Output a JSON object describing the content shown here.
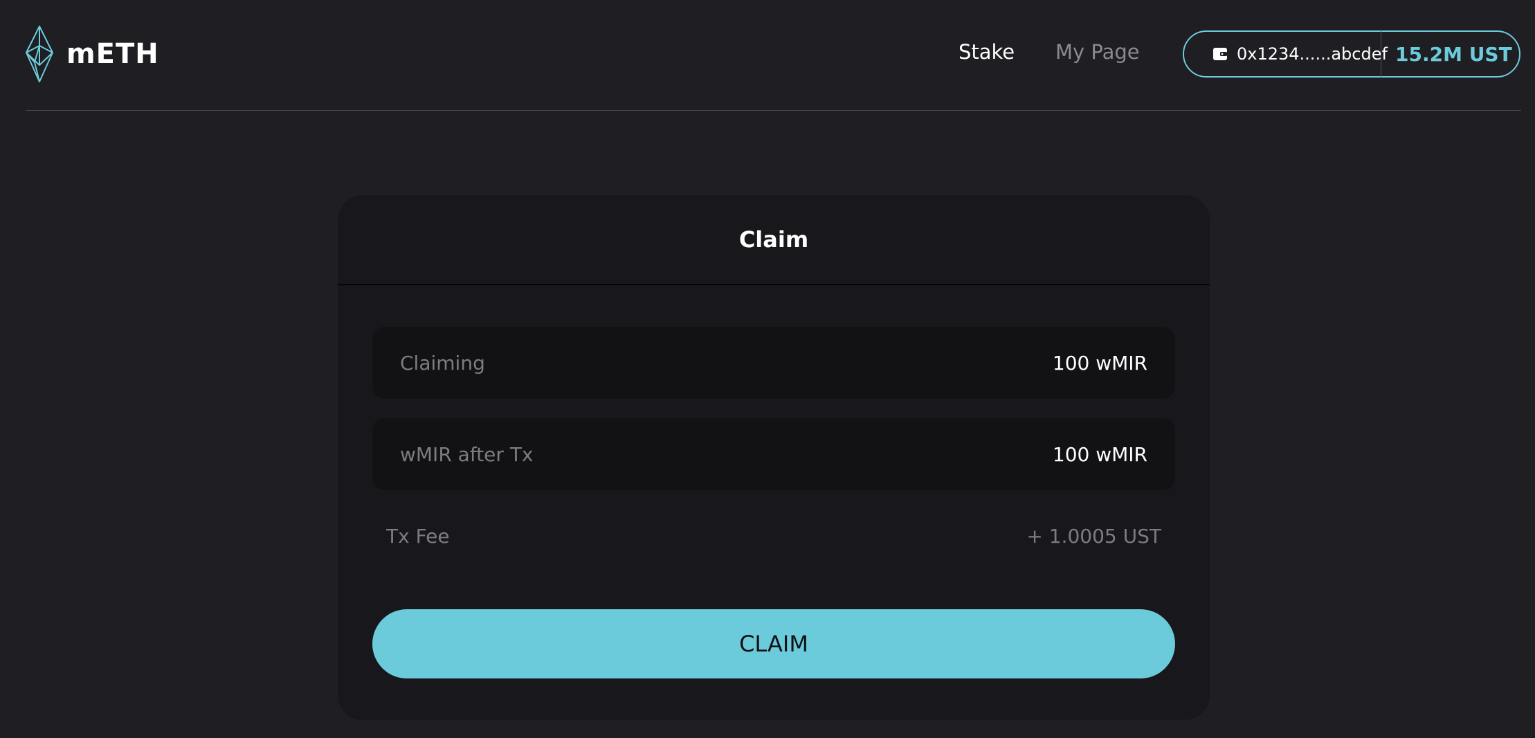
{
  "brand": {
    "name": "mETH",
    "accent": "#6ccbdb"
  },
  "nav": {
    "stake": "Stake",
    "my_page": "My Page"
  },
  "wallet": {
    "icon": "wallet-icon",
    "address": "0x1234......abcdef",
    "balance": "15.2M UST"
  },
  "claim_card": {
    "title": "Claim",
    "rows": [
      {
        "label": "Claiming",
        "value": "100 wMIR"
      },
      {
        "label": "wMIR after Tx",
        "value": "100 wMIR"
      }
    ],
    "fee": {
      "label": "Tx Fee",
      "value": "+ 1.0005 UST"
    },
    "button_label": "CLAIM"
  }
}
